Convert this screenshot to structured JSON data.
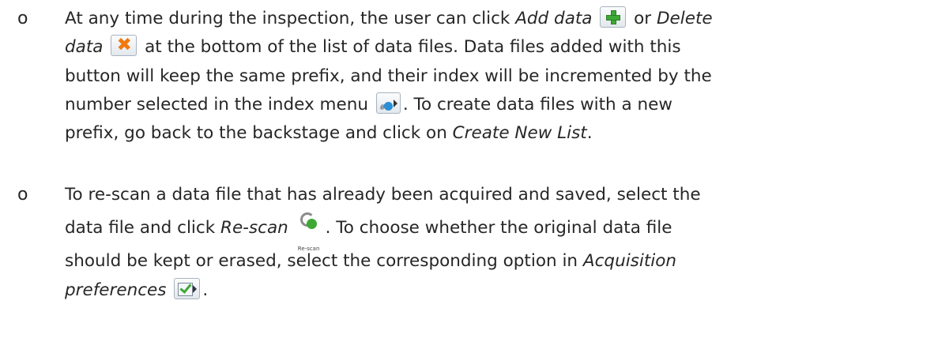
{
  "bullets": [
    {
      "marker": "o",
      "lines": {
        "l1a": "At any time during the inspection, the user can click ",
        "add_data": "Add data",
        "l1b": "or ",
        "delete": "Delete",
        "l2a_data": "data",
        "l2b": "at the bottom of the list of data files. Data files added with this",
        "l3": "button will keep the same prefix, and their index will be incremented by the",
        "l4a": "number selected in the index menu",
        "l4b": ". To create data files with a new",
        "l5a": "prefix, go back to the backstage and click on ",
        "create_new_list": "Create New List",
        "l5b": "."
      },
      "icons": {
        "add": "add-data-plus-icon",
        "delete": "delete-data-x-icon",
        "index": "index-menu-icon",
        "index_symbol": "#"
      }
    },
    {
      "marker": "o",
      "lines": {
        "l1": "To re-scan a data file that has already been acquired and saved, select the",
        "l2a": "data file and click ",
        "rescan": "Re-scan",
        "l2b": ". To choose whether the original data file",
        "l3a": "should be kept or erased, select the corresponding option in ",
        "acq": "Acquisition",
        "l4a": "preferences",
        "l4b": "."
      },
      "icons": {
        "rescan": "rescan-icon",
        "rescan_label": "Re-scan",
        "acq_prefs": "acquisition-preferences-icon"
      }
    }
  ]
}
